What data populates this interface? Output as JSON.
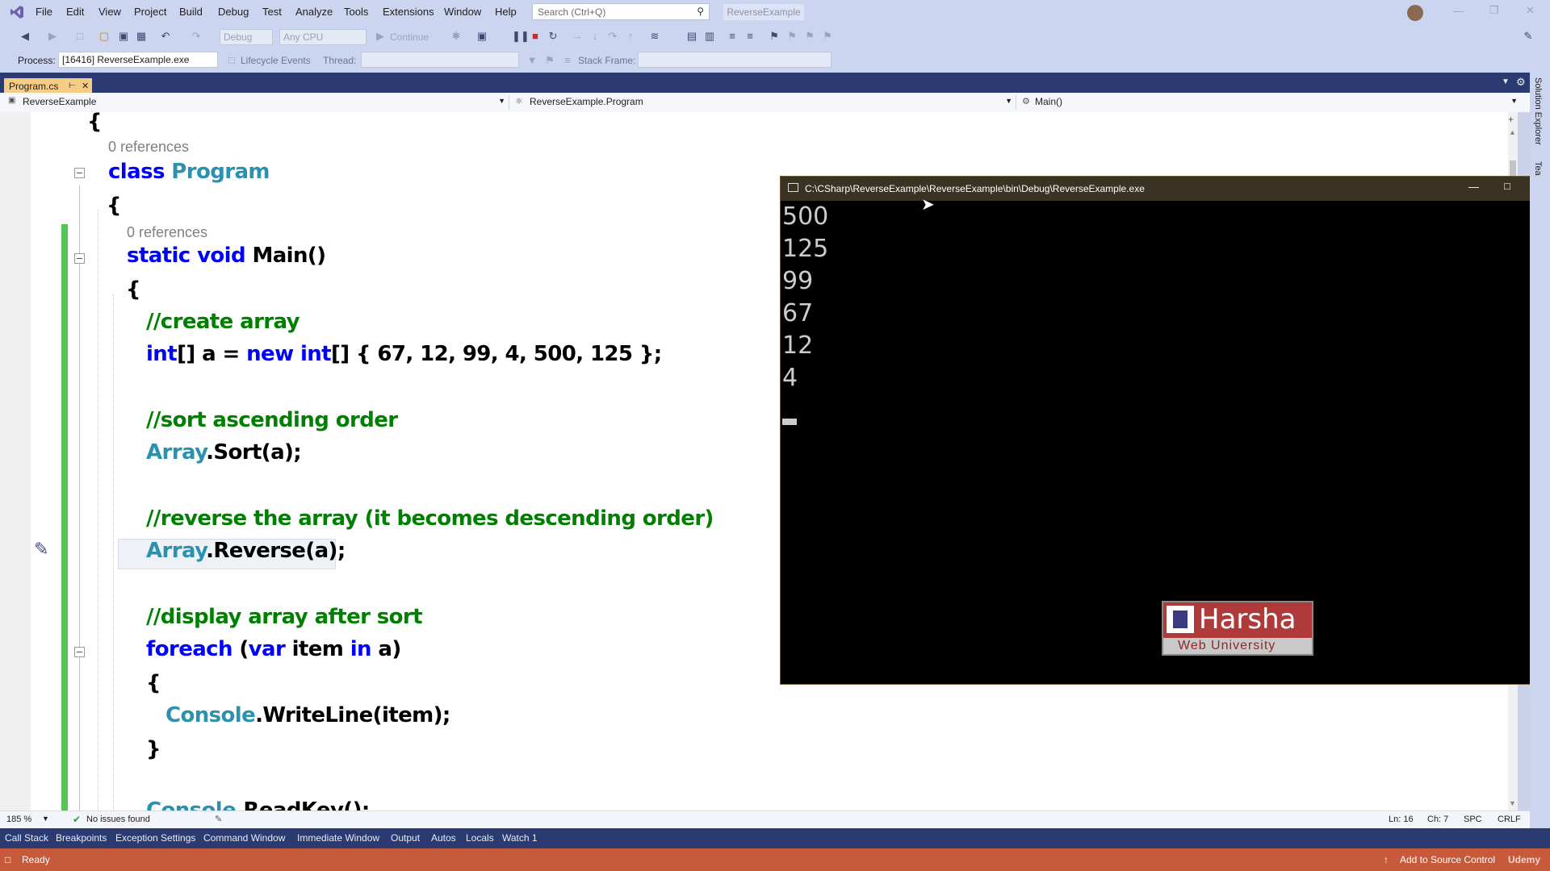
{
  "menu": [
    "File",
    "Edit",
    "View",
    "Project",
    "Build",
    "Debug",
    "Test",
    "Analyze",
    "Tools",
    "Extensions",
    "Window",
    "Help"
  ],
  "search": {
    "placeholder": "Search (Ctrl+Q)"
  },
  "solution_name": "ReverseExample",
  "toolbar": {
    "config": "Debug",
    "platform": "Any CPU",
    "continue_label": "Continue",
    "process_label": "Process:",
    "process_value": "[16416] ReverseExample.exe",
    "lifecycle_label": "Lifecycle Events",
    "thread_label": "Thread:",
    "stackframe_label": "Stack Frame:"
  },
  "tab": {
    "label": "Program.cs"
  },
  "navbar": {
    "project": "ReverseExample",
    "class": "ReverseExample.Program",
    "member": "Main()"
  },
  "code": {
    "brace_open": "{",
    "refs0": "0 references",
    "class_kw": "class",
    "class_name": "Program",
    "brace1": "{",
    "refs1": "0 references",
    "static_kw": "static",
    "void_kw": "void",
    "main_sig": "Main()",
    "brace2": "{",
    "c1": "//create array",
    "l1_a": "int",
    "l1_b": "[] a = ",
    "l1_c": "new",
    "l1_d": " ",
    "l1_e": "int",
    "l1_f": "[] { 67, 12, 99, 4, 500, 125 };",
    "c2": "//sort ascending order",
    "l2_a": "Array",
    "l2_b": ".Sort(a);",
    "c3": "//reverse the array (it becomes descending order)",
    "l3_a": "Array",
    "l3_b": ".Reverse(a);",
    "c4": "//display array after sort",
    "l4_a": "foreach",
    "l4_b": " (",
    "l4_c": "var",
    "l4_d": " item ",
    "l4_e": "in",
    "l4_f": " a)",
    "brace3": "{",
    "l5_a": "Console",
    "l5_b": ".WriteLine(item);",
    "brace4": "}",
    "l6_a": "Console",
    "l6_b": ".ReadKey();"
  },
  "console": {
    "title": "C:\\CSharp\\ReverseExample\\ReverseExample\\bin\\Debug\\ReverseExample.exe",
    "lines": [
      "500",
      "125",
      "99",
      "67",
      "12",
      "4"
    ],
    "watermark_1": "Harsha",
    "watermark_2": "Web University"
  },
  "editor_status": {
    "zoom": "185 %",
    "issues": "No issues found",
    "ln": "Ln: 16",
    "ch": "Ch: 7",
    "spc": "SPC",
    "crlf": "CRLF"
  },
  "tool_tabs": [
    "Call Stack",
    "Breakpoints",
    "Exception Settings",
    "Command Window",
    "Immediate Window",
    "Output",
    "Autos",
    "Locals",
    "Watch 1"
  ],
  "statusbar": {
    "ready": "Ready",
    "source_control": "Add to Source Control",
    "udemy": "Udemy"
  },
  "right_rail": {
    "solution_explorer": "Solution Explorer",
    "team": "Tea"
  },
  "colors": {
    "keyword": "#0000ff",
    "type": "#2b91af",
    "comment": "#008000",
    "status": "#c65a3a",
    "tab_active": "#f5cc84"
  }
}
